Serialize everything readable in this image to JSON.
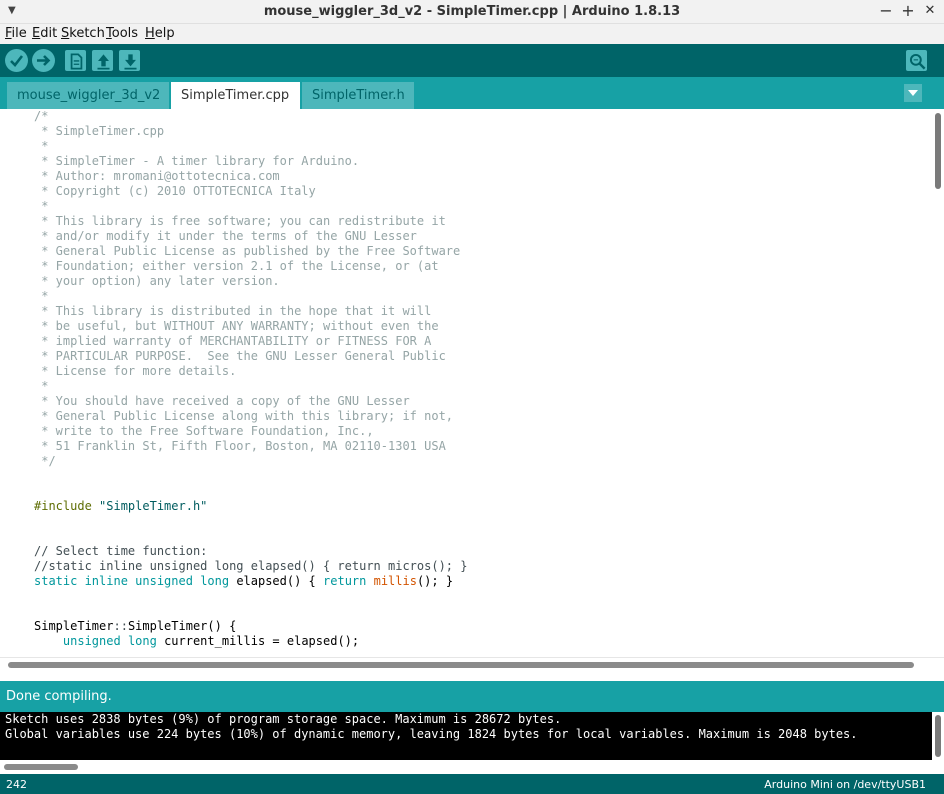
{
  "window": {
    "title": "mouse_wiggler_3d_v2 - SimpleTimer.cpp | Arduino 1.8.13",
    "minimize": "−",
    "maximize": "+",
    "close": "✕"
  },
  "menu": {
    "items": [
      {
        "first": "F",
        "rest": "ile"
      },
      {
        "first": "E",
        "rest": "dit"
      },
      {
        "first": "S",
        "rest": "ketch"
      },
      {
        "first": "T",
        "rest": "ools"
      },
      {
        "first": "H",
        "rest": "elp"
      }
    ]
  },
  "toolbar": {
    "icons": [
      "verify-icon",
      "upload-icon",
      "new-icon",
      "open-icon",
      "save-icon",
      "serial-monitor-icon"
    ],
    "accent": "#4db7bb",
    "background": "#006468"
  },
  "tabs": [
    {
      "label": "mouse_wiggler_3d_v2",
      "active": false
    },
    {
      "label": "SimpleTimer.cpp",
      "active": true
    },
    {
      "label": "SimpleTimer.h",
      "active": false
    }
  ],
  "editor": {
    "lines": [
      [
        {
          "t": "/*",
          "c": "c-comment"
        }
      ],
      [
        {
          "t": " * SimpleTimer.cpp",
          "c": "c-comment"
        }
      ],
      [
        {
          "t": " *",
          "c": "c-comment"
        }
      ],
      [
        {
          "t": " * SimpleTimer - A timer library for Arduino.",
          "c": "c-comment"
        }
      ],
      [
        {
          "t": " * Author: mromani@ottotecnica.com",
          "c": "c-comment"
        }
      ],
      [
        {
          "t": " * Copyright (c) 2010 OTTOTECNICA Italy",
          "c": "c-comment"
        }
      ],
      [
        {
          "t": " *",
          "c": "c-comment"
        }
      ],
      [
        {
          "t": " * This library is free software; you can redistribute it",
          "c": "c-comment"
        }
      ],
      [
        {
          "t": " * and/or modify it under the terms of the GNU Lesser",
          "c": "c-comment"
        }
      ],
      [
        {
          "t": " * General Public License as published by the Free Software",
          "c": "c-comment"
        }
      ],
      [
        {
          "t": " * Foundation; either version 2.1 of the License, or (at",
          "c": "c-comment"
        }
      ],
      [
        {
          "t": " * your option) any later version.",
          "c": "c-comment"
        }
      ],
      [
        {
          "t": " *",
          "c": "c-comment"
        }
      ],
      [
        {
          "t": " * This library is distributed in the hope that it will",
          "c": "c-comment"
        }
      ],
      [
        {
          "t": " * be useful, but WITHOUT ANY WARRANTY; without even the",
          "c": "c-comment"
        }
      ],
      [
        {
          "t": " * implied warranty of MERCHANTABILITY or FITNESS FOR A",
          "c": "c-comment"
        }
      ],
      [
        {
          "t": " * PARTICULAR PURPOSE.  See the GNU Lesser General Public",
          "c": "c-comment"
        }
      ],
      [
        {
          "t": " * License for more details.",
          "c": "c-comment"
        }
      ],
      [
        {
          "t": " *",
          "c": "c-comment"
        }
      ],
      [
        {
          "t": " * You should have received a copy of the GNU Lesser",
          "c": "c-comment"
        }
      ],
      [
        {
          "t": " * General Public License along with this library; if not,",
          "c": "c-comment"
        }
      ],
      [
        {
          "t": " * write to the Free Software Foundation, Inc.,",
          "c": "c-comment"
        }
      ],
      [
        {
          "t": " * 51 Franklin St, Fifth Floor, Boston, MA 02110-1301 USA",
          "c": "c-comment"
        }
      ],
      [
        {
          "t": " */",
          "c": "c-comment"
        }
      ],
      [],
      [],
      [
        {
          "t": "#include ",
          "c": "c-pre"
        },
        {
          "t": "\"SimpleTimer.h\"",
          "c": "c-str"
        }
      ],
      [],
      [],
      [
        {
          "t": "// Select time function:",
          "c": "c-gray"
        }
      ],
      [
        {
          "t": "//static inline unsigned long elapsed() { return micros(); }",
          "c": "c-gray"
        }
      ],
      [
        {
          "t": "static ",
          "c": "c-kw"
        },
        {
          "t": "inline ",
          "c": "c-kw"
        },
        {
          "t": "unsigned ",
          "c": "c-kw"
        },
        {
          "t": "long ",
          "c": "c-kw"
        },
        {
          "t": "elapsed() { ",
          "c": ""
        },
        {
          "t": "return ",
          "c": "c-kw"
        },
        {
          "t": "millis",
          "c": "c-fn"
        },
        {
          "t": "(); }",
          "c": ""
        }
      ],
      [],
      [],
      [
        {
          "t": "SimpleTimer",
          "c": ""
        },
        {
          "t": "::",
          "c": "c-gray"
        },
        {
          "t": "SimpleTimer() {",
          "c": ""
        }
      ],
      [
        {
          "t": "    ",
          "c": ""
        },
        {
          "t": "unsigned ",
          "c": "c-kw"
        },
        {
          "t": "long ",
          "c": "c-kw"
        },
        {
          "t": "current_millis = elapsed();",
          "c": ""
        }
      ]
    ]
  },
  "status": {
    "message": "Done compiling."
  },
  "console": {
    "lines": [
      "Sketch uses 2838 bytes (9%) of program storage space. Maximum is 28672 bytes.",
      "Global variables use 224 bytes (10%) of dynamic memory, leaving 1824 bytes for local variables. Maximum is 2048 bytes."
    ]
  },
  "footer": {
    "line_number": "242",
    "board": "Arduino Mini on /dev/ttyUSB1"
  }
}
